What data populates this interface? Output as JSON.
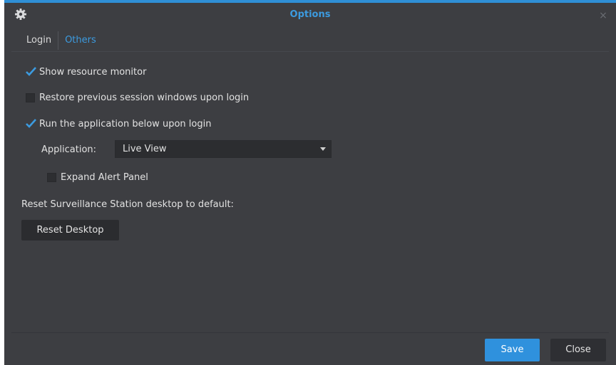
{
  "window": {
    "title": "Options",
    "close_glyph": "×",
    "accent_color": "#2f8fd6"
  },
  "tabs": [
    {
      "label": "Login",
      "active": false
    },
    {
      "label": "Others",
      "active": true
    }
  ],
  "options": {
    "show_resource_monitor": {
      "label": "Show resource monitor",
      "checked": true
    },
    "restore_sessions": {
      "label": "Restore previous session windows upon login",
      "checked": false
    },
    "run_application": {
      "label": "Run the application below upon login",
      "checked": true
    },
    "application": {
      "label": "Application:",
      "value": "Live View"
    },
    "expand_alert_panel": {
      "label": "Expand Alert Panel",
      "checked": false
    }
  },
  "reset": {
    "label": "Reset Surveillance Station desktop to default:",
    "button_label": "Reset Desktop"
  },
  "footer": {
    "save_label": "Save",
    "close_label": "Close"
  }
}
